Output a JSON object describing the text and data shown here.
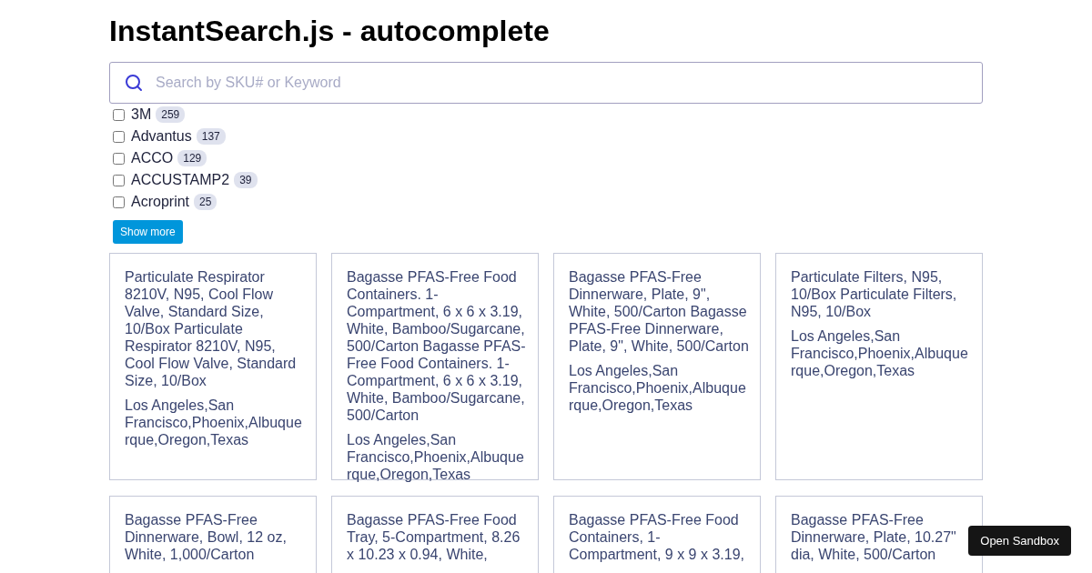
{
  "title": "InstantSearch.js - autocomplete",
  "search": {
    "placeholder": "Search by SKU# or Keyword"
  },
  "refinements": [
    {
      "label": "3M",
      "count": "259",
      "checked": false
    },
    {
      "label": "Advantus",
      "count": "137",
      "checked": false
    },
    {
      "label": "ACCO",
      "count": "129",
      "checked": false
    },
    {
      "label": "ACCUSTAMP2",
      "count": "39",
      "checked": false
    },
    {
      "label": "Acroprint",
      "count": "25",
      "checked": false
    }
  ],
  "show_more": "Show more",
  "hits": [
    {
      "name": "Particulate Respirator 8210V, N95, Cool Flow Valve, Standard Size, 10/Box Particulate Respirator 8210V, N95, Cool Flow Valve, Standard Size, 10/Box",
      "locations": "Los Angeles,San Francisco,Phoenix,Albuquerque,Oregon,Texas"
    },
    {
      "name": "Bagasse PFAS-Free Food Containers. 1-Compartment, 6 x 6 x 3.19, White, Bamboo/Sugarcane, 500/Carton Bagasse PFAS-Free Food Containers. 1-Compartment, 6 x 6 x 3.19, White, Bamboo/Sugarcane, 500/Carton",
      "locations": "Los Angeles,San Francisco,Phoenix,Albuquerque,Oregon,Texas"
    },
    {
      "name": "Bagasse PFAS-Free Dinnerware, Plate, 9\", White, 500/Carton Bagasse PFAS-Free Dinnerware, Plate, 9\", White, 500/Carton",
      "locations": "Los Angeles,San Francisco,Phoenix,Albuquerque,Oregon,Texas"
    },
    {
      "name": "Particulate Filters, N95, 10/Box Particulate Filters, N95, 10/Box",
      "locations": "Los Angeles,San Francisco,Phoenix,Albuquerque,Oregon,Texas"
    },
    {
      "name": "Bagasse PFAS-Free Dinnerware, Bowl, 12 oz, White, 1,000/Carton"
    },
    {
      "name": "Bagasse PFAS-Free Food Tray, 5-Compartment, 8.26 x 10.23 x 0.94, White,"
    },
    {
      "name": "Bagasse PFAS-Free Food Containers, 1-Compartment, 9 x 9 x 3.19,"
    },
    {
      "name": "Bagasse PFAS-Free Dinnerware, Plate, 10.27\" dia, White, 500/Carton"
    }
  ],
  "sandbox_button": "Open Sandbox"
}
